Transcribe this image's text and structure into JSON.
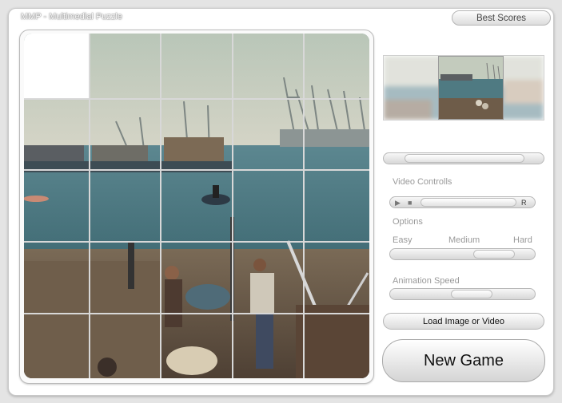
{
  "app": {
    "title": "MMP - Multimedial Puzzle"
  },
  "header": {
    "best_scores_label": "Best Scores"
  },
  "video_controls": {
    "label": "Video Controlls",
    "rewind_label": "R"
  },
  "options": {
    "label": "Options",
    "difficulty": {
      "easy": "Easy",
      "medium": "Medium",
      "hard": "Hard"
    }
  },
  "animation_speed": {
    "label": "Animation Speed"
  },
  "buttons": {
    "load": "Load Image or Video",
    "new_game": "New Game"
  },
  "colors": {
    "sky": "#c6ccbf",
    "water": "#4f7a82",
    "shore": "#6b5a48",
    "empty_tile": "#ffffff"
  }
}
